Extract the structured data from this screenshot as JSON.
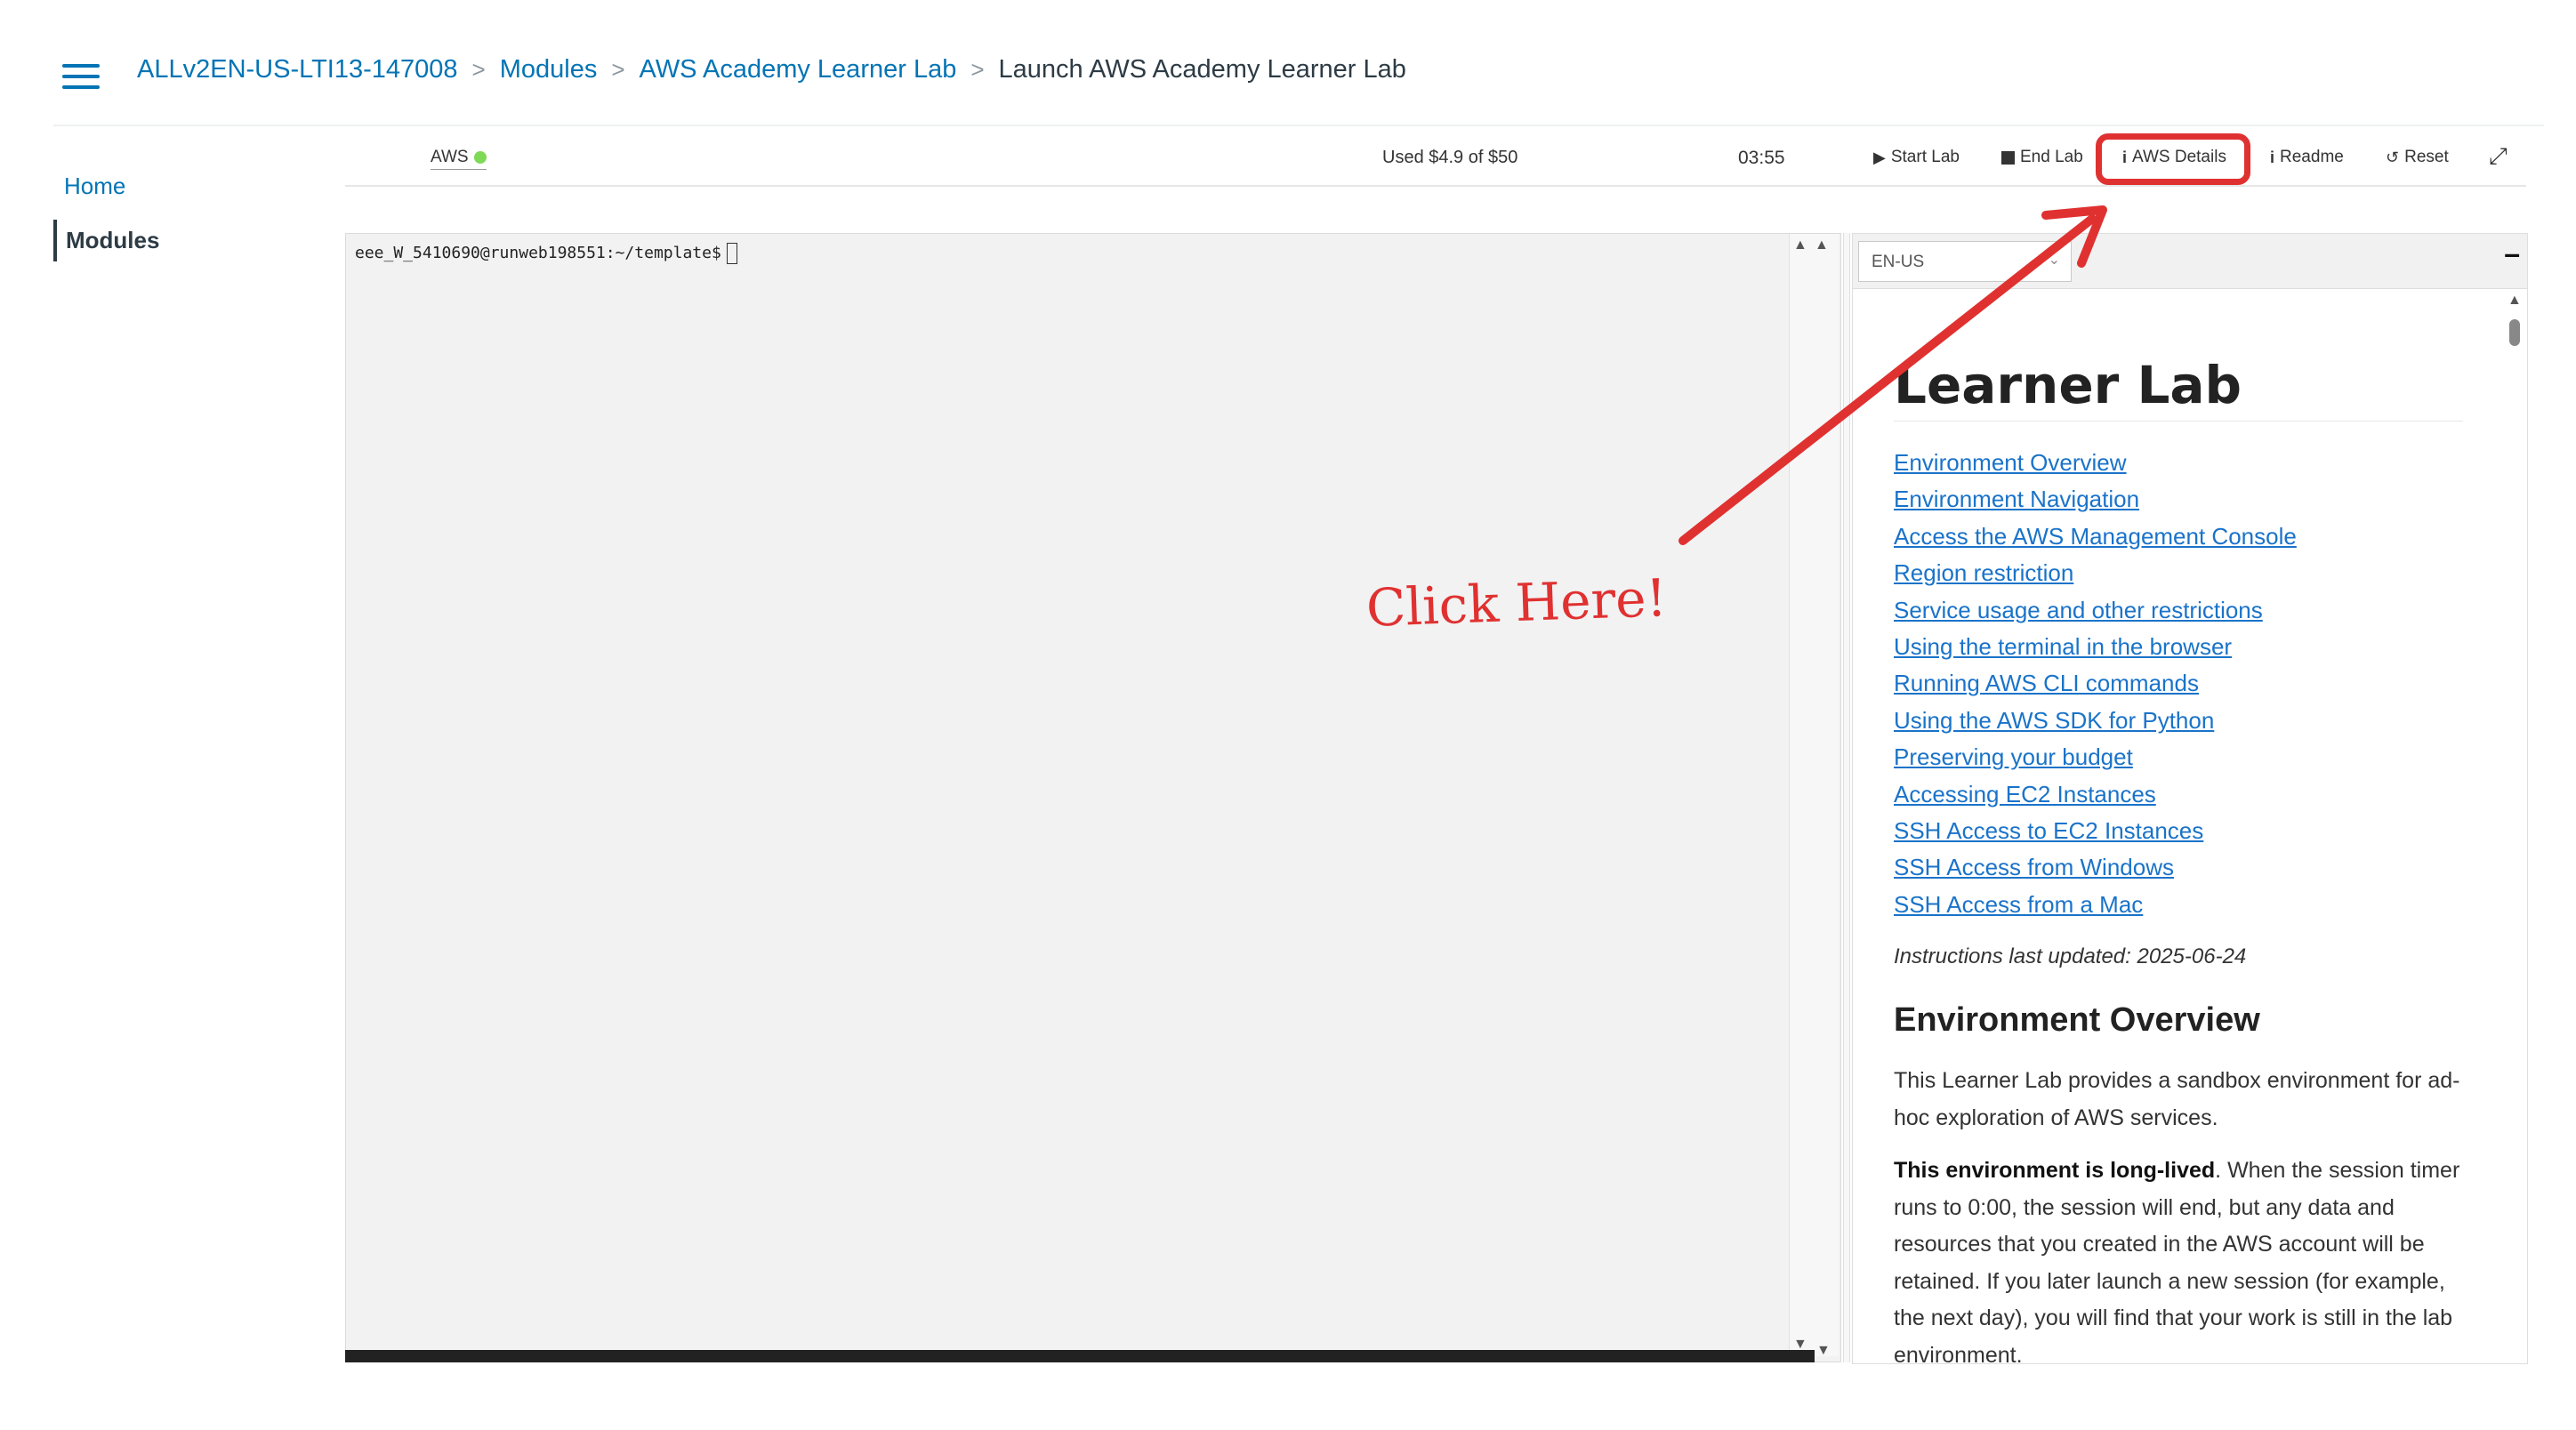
{
  "breadcrumb": {
    "course": "ALLv2EN-US-LTI13-147008",
    "modules": "Modules",
    "module_item": "AWS Academy Learner Lab",
    "current": "Launch AWS Academy Learner Lab",
    "separator": ">"
  },
  "course_nav": {
    "home": "Home",
    "modules": "Modules"
  },
  "toolbar": {
    "aws_label": "AWS",
    "aws_status_color": "#7ed957",
    "budget": "Used $4.9 of $50",
    "timer": "03:55",
    "start_lab": "Start Lab",
    "end_lab": "End Lab",
    "aws_details": "AWS Details",
    "readme": "Readme",
    "reset": "Reset"
  },
  "terminal": {
    "prompt": "eee_W_5410690@runweb198551:~/template$"
  },
  "readme": {
    "language": "EN-US",
    "title": "Learner Lab",
    "toc": [
      "Environment Overview",
      "Environment Navigation",
      "Access the AWS Management Console",
      "Region restriction",
      "Service usage and other restrictions",
      "Using the terminal in the browser",
      "Running AWS CLI commands",
      "Using the AWS SDK for Python",
      "Preserving your budget",
      "Accessing EC2 Instances",
      "SSH Access to EC2 Instances",
      "SSH Access from Windows",
      "SSH Access from a Mac"
    ],
    "updated": "Instructions last updated: 2025-06-24",
    "section_heading": "Environment Overview",
    "para1": "This Learner Lab provides a sandbox environment for ad-hoc exploration of AWS services.",
    "para2_bold": "This environment is long-lived",
    "para2_rest": ". When the session timer runs to 0:00, the session will end, but any data and resources that you created in the AWS account will be retained. If you later launch a new session (for example, the next day), you will find that your work is still in the lab environment."
  },
  "annotation": {
    "text": "Click Here!",
    "color": "#e03131"
  },
  "colors": {
    "link": "#0374b5",
    "readme_link": "#1a73c9",
    "accent_red": "#e03131"
  }
}
